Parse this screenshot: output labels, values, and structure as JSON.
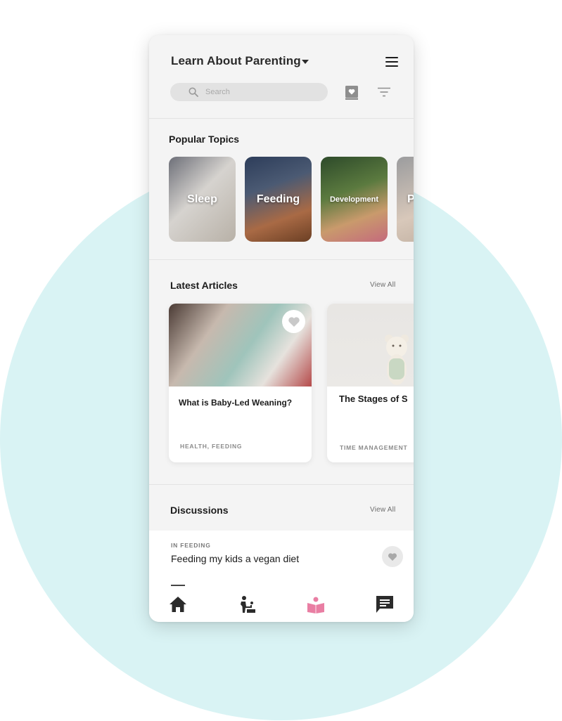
{
  "header": {
    "title": "Learn About Parenting",
    "search_placeholder": "Search"
  },
  "icons": {
    "title_dropdown": "caret-down-icon",
    "menu": "hamburger-menu-icon",
    "search": "search-icon",
    "saved": "bookmark-heart-icon",
    "filter": "filter-icon"
  },
  "popular_topics": {
    "title": "Popular Topics",
    "items": [
      {
        "label": "Sleep"
      },
      {
        "label": "Feeding"
      },
      {
        "label": "Development"
      },
      {
        "label": "P"
      }
    ]
  },
  "latest_articles": {
    "title": "Latest Articles",
    "view_all": "View All",
    "items": [
      {
        "title": "What is Baby-Led Weaning?",
        "tags": "HEALTH, FEEDING"
      },
      {
        "title": "The Stages of S",
        "tags": "TIME MANAGEMENT"
      }
    ]
  },
  "discussions": {
    "title": "Discussions",
    "view_all": "View All",
    "items": [
      {
        "category": "IN FEEDING",
        "title": "Feeding my kids a vegan diet"
      }
    ]
  },
  "bottom_nav": {
    "items": [
      {
        "icon": "home-icon"
      },
      {
        "icon": "baby-care-icon"
      },
      {
        "icon": "learn-book-icon",
        "active": true
      },
      {
        "icon": "chat-icon"
      }
    ]
  },
  "colors": {
    "background_circle": "#d9f3f4",
    "accent": "#e97ea3",
    "screen_bg": "#f4f4f4",
    "text_primary": "#1c1c1c"
  }
}
